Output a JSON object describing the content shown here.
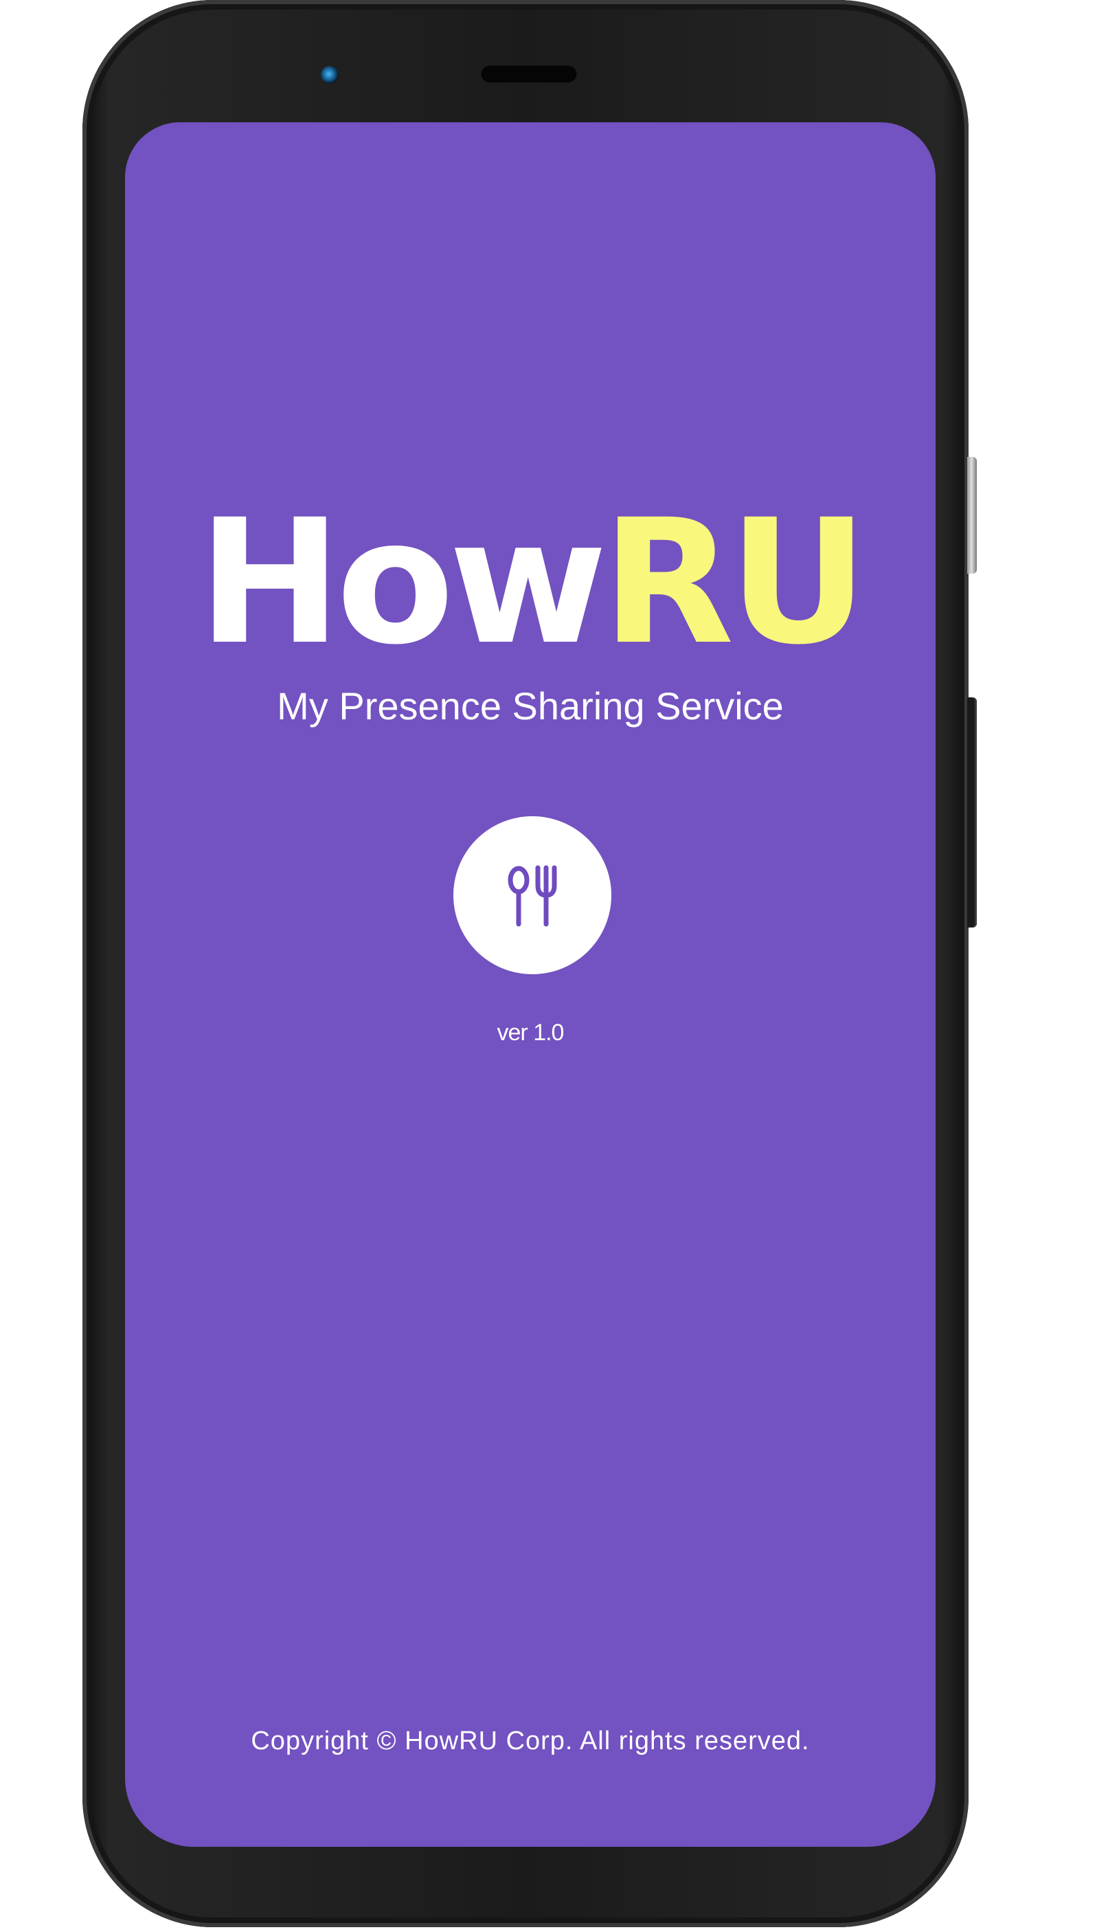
{
  "app": {
    "logo_part1": "How",
    "logo_part2": "RU",
    "tagline": "My Presence Sharing Service",
    "version": "ver 1.0",
    "copyright": "Copyright © HowRU Corp. All rights reserved."
  },
  "icons": {
    "center": "spoon-fork-icon",
    "camera": "camera-icon"
  },
  "colors": {
    "background": "#7352c1",
    "logo_white": "#ffffff",
    "logo_accent": "#f9f77c",
    "icon_circle": "#ffffff",
    "icon_stroke": "#6f4bc0"
  }
}
